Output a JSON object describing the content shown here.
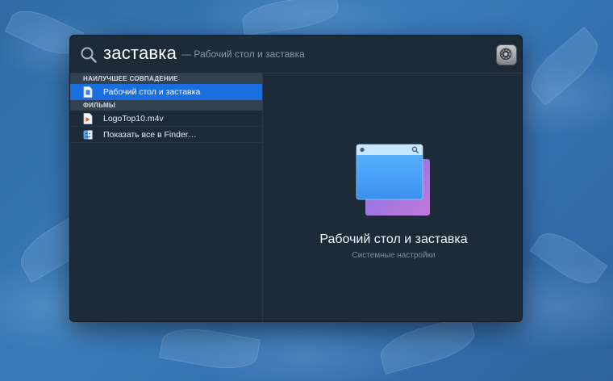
{
  "search": {
    "query": "заставка",
    "hint": "— Рабочий стол и заставка"
  },
  "results": {
    "sections": [
      {
        "header": "НАИЛУЧШЕЕ СОВПАДЕНИЕ",
        "items": [
          {
            "label": "Рабочий стол и заставка",
            "icon": "prefs-document-icon",
            "selected": true
          }
        ]
      },
      {
        "header": "ФИЛЬМЫ",
        "items": [
          {
            "label": "LogoTop10.m4v",
            "icon": "movie-file-icon",
            "selected": false
          },
          {
            "label": "Показать все в Finder…",
            "icon": "finder-icon",
            "selected": false
          }
        ]
      }
    ]
  },
  "preview": {
    "title": "Рабочий стол и заставка",
    "subtitle": "Системные настройки",
    "icon": "desktop-screensaver-icon"
  },
  "colors": {
    "selection": "#1a6fe0",
    "panel": "#1d2a38",
    "section_header": "#34424f"
  }
}
